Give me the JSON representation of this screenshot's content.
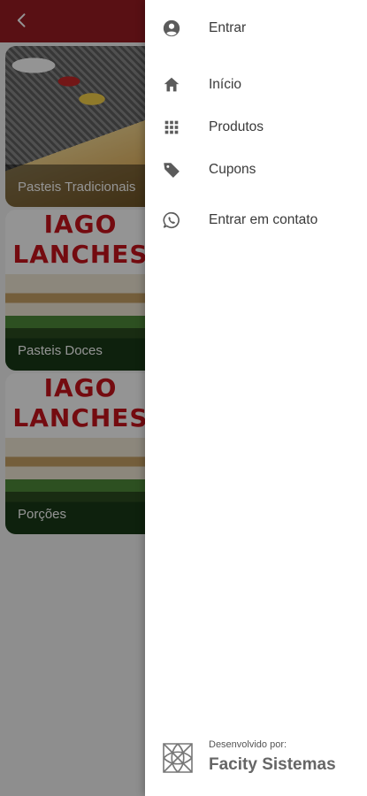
{
  "app": {
    "back_icon": "arrow-back-icon",
    "bar_color": "#9a1c24"
  },
  "categories": [
    {
      "label": "Pasteis Tradicionais",
      "image": "food-photo"
    },
    {
      "label": "Pasteis Doces",
      "image": "iago-lanches-logo",
      "brand": "IAGO\nLANCHES"
    },
    {
      "label": "Porções",
      "image": "iago-lanches-logo",
      "brand": "IAGO\nLANCHES"
    }
  ],
  "drawer": {
    "login": {
      "label": "Entrar",
      "icon": "account-circle-icon"
    },
    "items": [
      {
        "label": "Início",
        "icon": "home-icon"
      },
      {
        "label": "Produtos",
        "icon": "grid-icon"
      },
      {
        "label": "Cupons",
        "icon": "tag-icon"
      },
      {
        "label": "Entrar em contato",
        "icon": "whatsapp-icon"
      }
    ],
    "credits": {
      "developed_by": "Desenvolvido por:",
      "company": "Facity Sistemas"
    }
  }
}
